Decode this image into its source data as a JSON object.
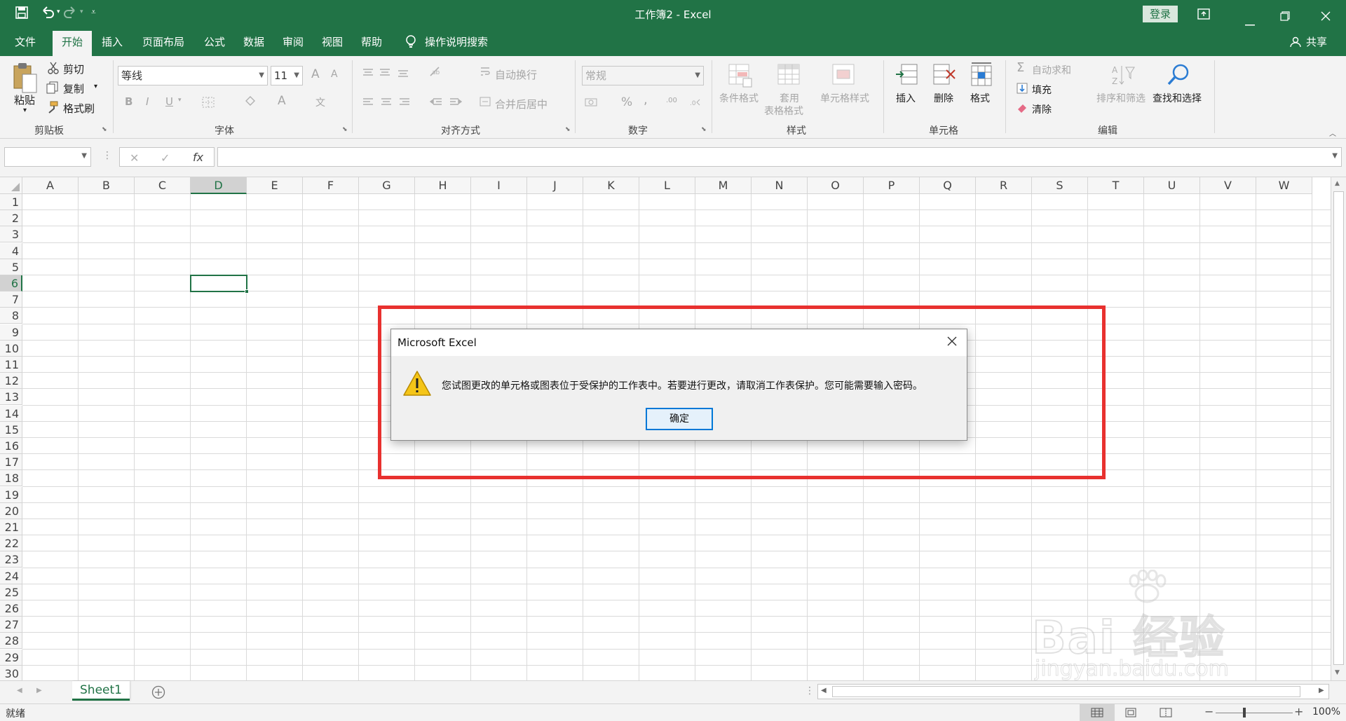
{
  "app": {
    "window_title": "工作簿2 - Excel",
    "login_label": "登录",
    "share_label": "共享"
  },
  "tabs": [
    "文件",
    "开始",
    "插入",
    "页面布局",
    "公式",
    "数据",
    "审阅",
    "视图",
    "帮助",
    "操作说明搜索"
  ],
  "ribbon": {
    "clipboard": {
      "paste": "粘贴",
      "cut": "剪切",
      "copy": "复制",
      "format_painter": "格式刷",
      "group": "剪贴板"
    },
    "font": {
      "name": "等线",
      "size": "11",
      "group": "字体",
      "bold": "B",
      "italic": "I",
      "underline": "U",
      "grow": "A",
      "shrink": "A",
      "color": "A",
      "phonetic": "文"
    },
    "alignment": {
      "wrap": "自动换行",
      "merge": "合并后居中",
      "group": "对齐方式"
    },
    "number": {
      "format": "常规",
      "percent": "%",
      "comma": ",",
      "inc": ".00",
      "group": "数字"
    },
    "styles": {
      "conditional": "条件格式",
      "table_line1": "套用",
      "table_line2": "表格格式",
      "cell_styles": "单元格样式",
      "group": "样式"
    },
    "cells": {
      "insert": "插入",
      "delete": "删除",
      "format": "格式",
      "group": "单元格"
    },
    "editing": {
      "autosum": "自动求和",
      "fill": "填充",
      "clear": "清除",
      "sort": "排序和筛选",
      "find": "查找和选择",
      "group": "编辑"
    }
  },
  "formula_bar": {
    "name_box": "",
    "fx": "fx",
    "formula": ""
  },
  "columns": [
    "A",
    "B",
    "C",
    "D",
    "E",
    "F",
    "G",
    "H",
    "I",
    "J",
    "K",
    "L",
    "M",
    "N",
    "O",
    "P",
    "Q",
    "R",
    "S",
    "T",
    "U",
    "V",
    "W"
  ],
  "rows": [
    "1",
    "2",
    "3",
    "4",
    "5",
    "6",
    "7",
    "8",
    "9",
    "10",
    "11",
    "12",
    "13",
    "14",
    "15",
    "16",
    "17",
    "18",
    "19",
    "20",
    "21",
    "22",
    "23",
    "24",
    "25",
    "26",
    "27",
    "28",
    "29",
    "30"
  ],
  "active_cell": {
    "column": "D",
    "row": "6"
  },
  "dialog": {
    "title": "Microsoft Excel",
    "message": "您试图更改的单元格或图表位于受保护的工作表中。若要进行更改，请取消工作表保护。您可能需要输入密码。",
    "ok_label": "确定"
  },
  "highlight_color": "#e8312f",
  "accent_color": "#217346",
  "sheet_tabs": [
    "Sheet1"
  ],
  "status": {
    "ready": "就绪",
    "zoom": "100%"
  },
  "watermark": {
    "brand": "Bai 经验",
    "url": "jingyan.baidu.com"
  }
}
